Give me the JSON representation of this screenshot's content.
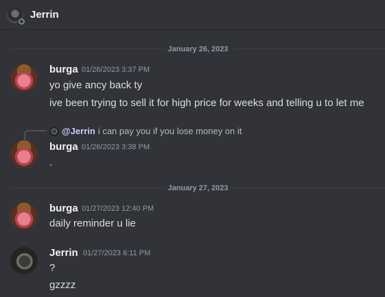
{
  "header": {
    "name": "Jerrin",
    "avatar_icon": "user-avatar-icon",
    "status": "offline"
  },
  "dividers": [
    "January 26, 2023",
    "January 27, 2023"
  ],
  "messages": [
    {
      "author": "burga",
      "timestamp": "01/26/2023 3:37 PM",
      "lines": [
        "yo give ancy back ty",
        "ive been trying to sell it for high price for weeks and telling u to let me"
      ]
    },
    {
      "author": "burga",
      "timestamp": "01/26/2023 3:38 PM",
      "reply": {
        "mention": "@Jerrin",
        "text": "i can pay you if you lose money on it"
      },
      "lines": [
        "."
      ]
    },
    {
      "author": "burga",
      "timestamp": "01/27/2023 12:40 PM",
      "lines": [
        "daily reminder u lie"
      ]
    },
    {
      "author": "Jerrin",
      "timestamp": "01/27/2023 6:11 PM",
      "lines": [
        "?",
        "gzzzz"
      ]
    }
  ],
  "colors": {
    "background": "#313338",
    "text": "#dbdee1",
    "muted": "#949ba4",
    "mention": "#c9cdfb"
  }
}
